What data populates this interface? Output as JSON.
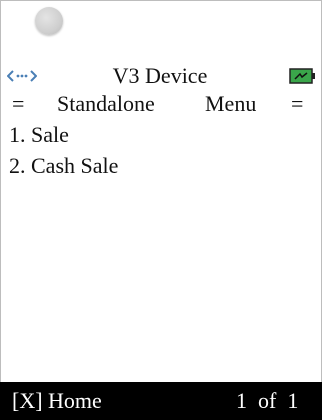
{
  "status": {
    "title": "V3 Device",
    "connection_icon": "link-arrows-icon",
    "battery_icon": "battery-charging-icon",
    "battery_color": "#3aa64a"
  },
  "menu": {
    "header_left": "=",
    "header_word1": "Standalone",
    "header_word2": "Menu",
    "header_right": "=",
    "items": [
      {
        "label": "1. Sale"
      },
      {
        "label": "2. Cash Sale"
      }
    ]
  },
  "footer": {
    "home_label": "[X] Home",
    "page_indicator": "1  of  1"
  }
}
